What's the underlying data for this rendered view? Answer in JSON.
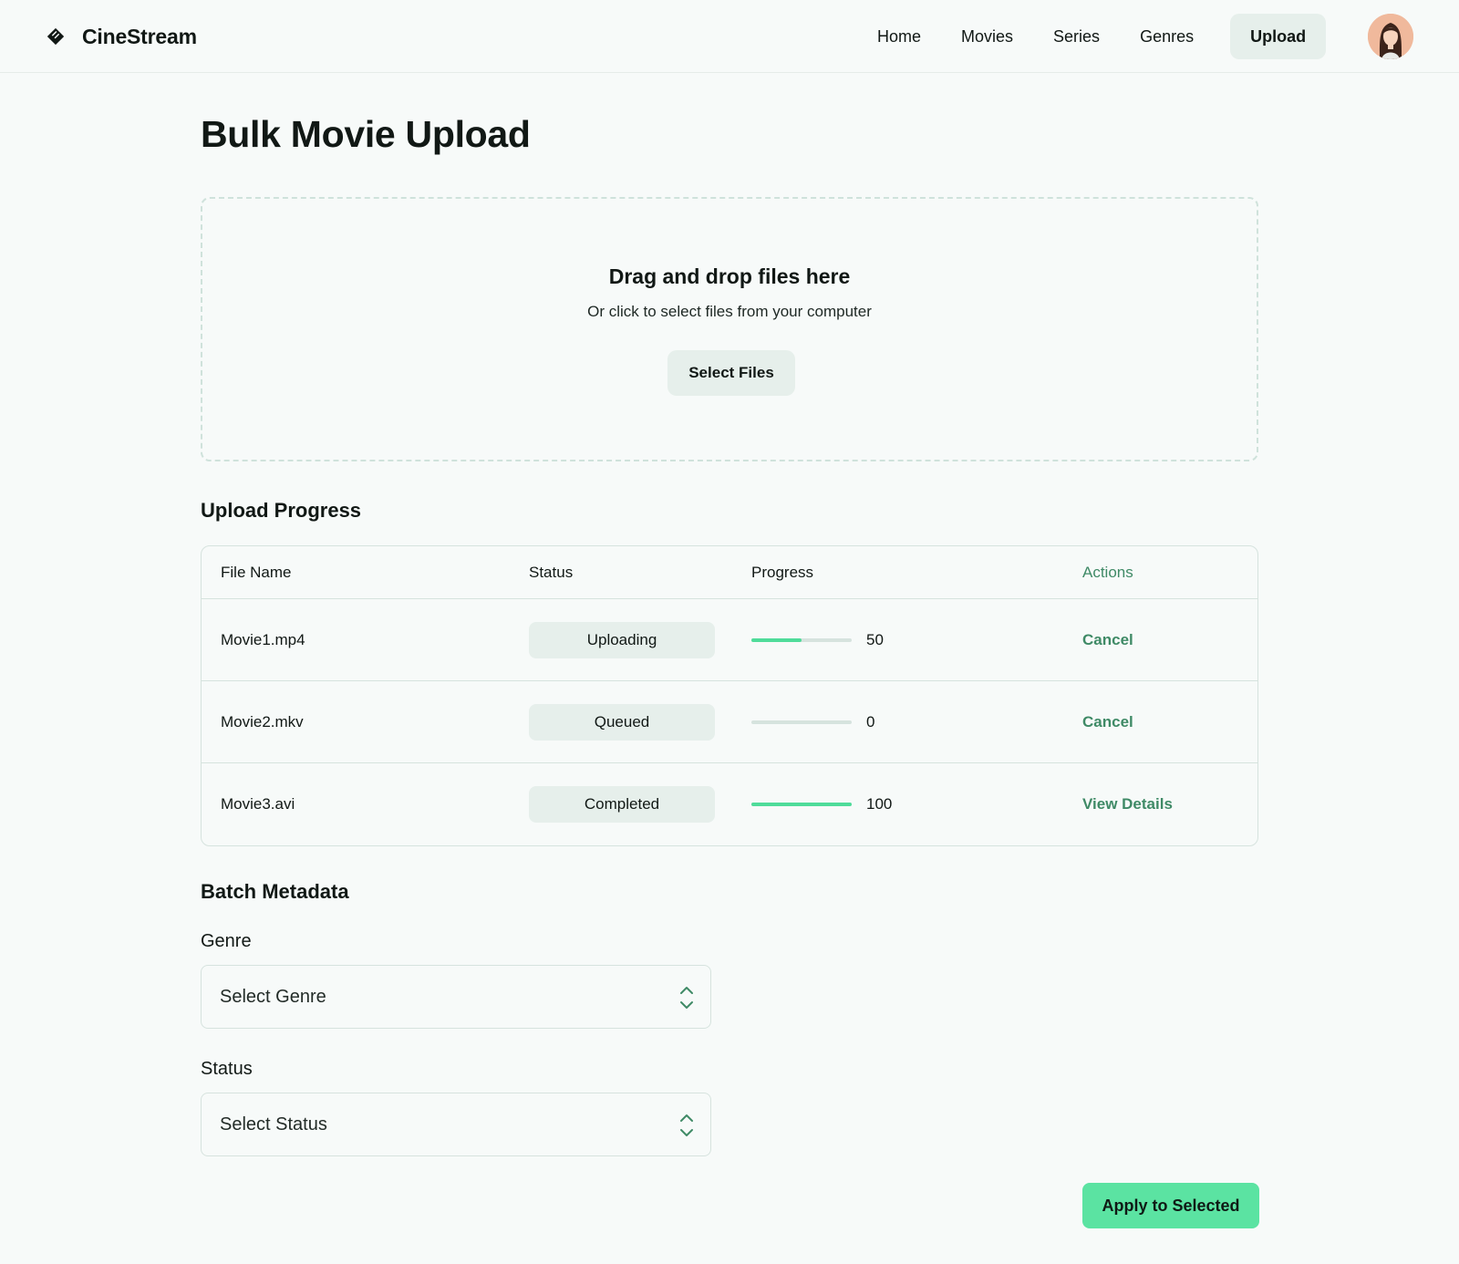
{
  "header": {
    "brand": "CineStream",
    "nav": [
      "Home",
      "Movies",
      "Series",
      "Genres"
    ],
    "active_nav": "Upload"
  },
  "page": {
    "title": "Bulk Movie Upload"
  },
  "dropzone": {
    "title": "Drag and drop files here",
    "subtitle": "Or click to select files from your computer",
    "button": "Select Files"
  },
  "upload_progress": {
    "title": "Upload Progress",
    "columns": [
      "File Name",
      "Status",
      "Progress",
      "Actions"
    ],
    "rows": [
      {
        "file": "Movie1.mp4",
        "status": "Uploading",
        "progress": 50,
        "progress_label": "50",
        "action": "Cancel"
      },
      {
        "file": "Movie2.mkv",
        "status": "Queued",
        "progress": 0,
        "progress_label": "0",
        "action": "Cancel"
      },
      {
        "file": "Movie3.avi",
        "status": "Completed",
        "progress": 100,
        "progress_label": "100",
        "action": "View Details"
      }
    ]
  },
  "batch_metadata": {
    "title": "Batch Metadata",
    "genre_label": "Genre",
    "genre_value": "Select Genre",
    "status_label": "Status",
    "status_value": "Select Status",
    "apply_button": "Apply to Selected"
  },
  "colors": {
    "accent": "#5be3a2",
    "progress_fill": "#4fdc9a",
    "link": "#3f8a66",
    "chip_bg": "#e6efeb",
    "border": "#d6e3de"
  },
  "icons": {
    "brand": "ticket-icon",
    "select_chevron": "chevron-up-down-icon"
  }
}
